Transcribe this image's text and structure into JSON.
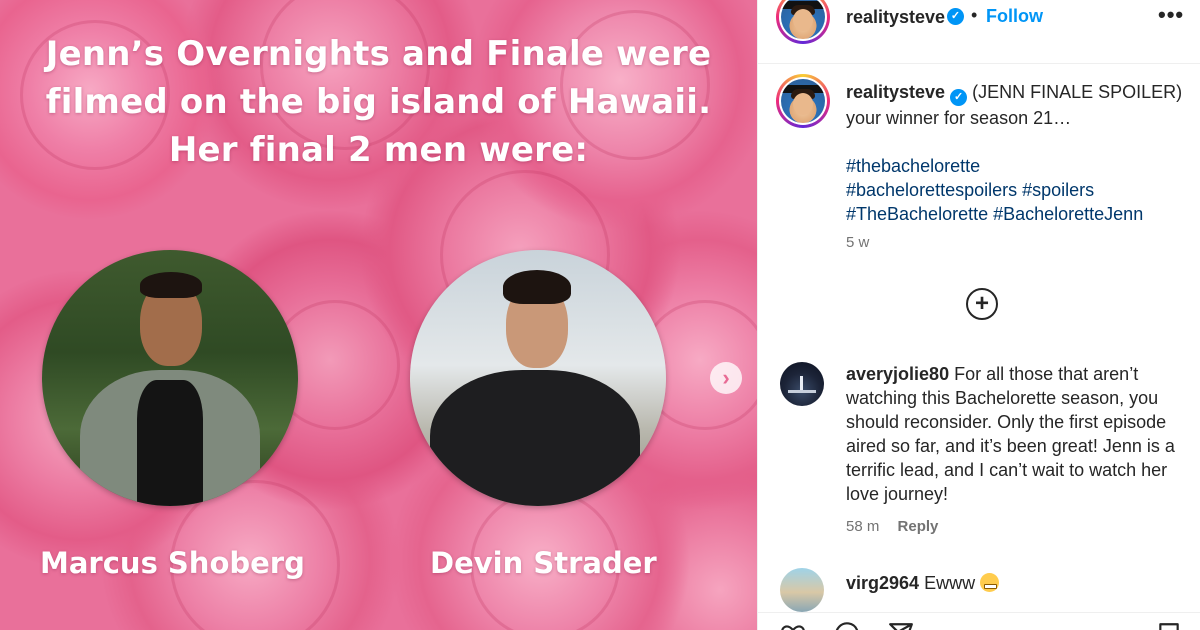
{
  "media": {
    "headline": [
      "Jenn’s Overnights and Finale were",
      "filmed on the big island of Hawaii.",
      "Her final 2 men were:"
    ],
    "contestants": [
      {
        "name": "Marcus Shoberg"
      },
      {
        "name": "Devin Strader"
      }
    ],
    "next_icon": "›"
  },
  "post_header": {
    "username": "realitysteve",
    "verified_icon": "✓",
    "separator": "•",
    "follow_label": "Follow",
    "more_icon": "•••"
  },
  "caption": {
    "username": "realitysteve",
    "text": "(JENN FINALE SPOILER) your winner for season 21…",
    "hashtags_line1": "#thebachelorette",
    "hashtags_line2": "#bachelorettespoilers #spoilers",
    "hashtags_line3": "#TheBachelorette #BacheloretteJenn",
    "time": "5 w"
  },
  "load_more_icon": "+",
  "comments": [
    {
      "username": "averyjolie80",
      "text": "For all those that aren’t watching this Bachelorette season, you should reconsider. Only the first episode aired so far, and it’s been great! Jenn is a terrific lead, and I can’t wait to watch her love journey!",
      "time": "58 m",
      "reply_label": "Reply"
    },
    {
      "username": "virg2964",
      "text": "Ewww",
      "emoji": "grimacing-face"
    }
  ],
  "colors": {
    "link_blue": "#0095f6",
    "hashtag": "#00376b",
    "muted": "#737373",
    "rose": "#e9709a"
  }
}
